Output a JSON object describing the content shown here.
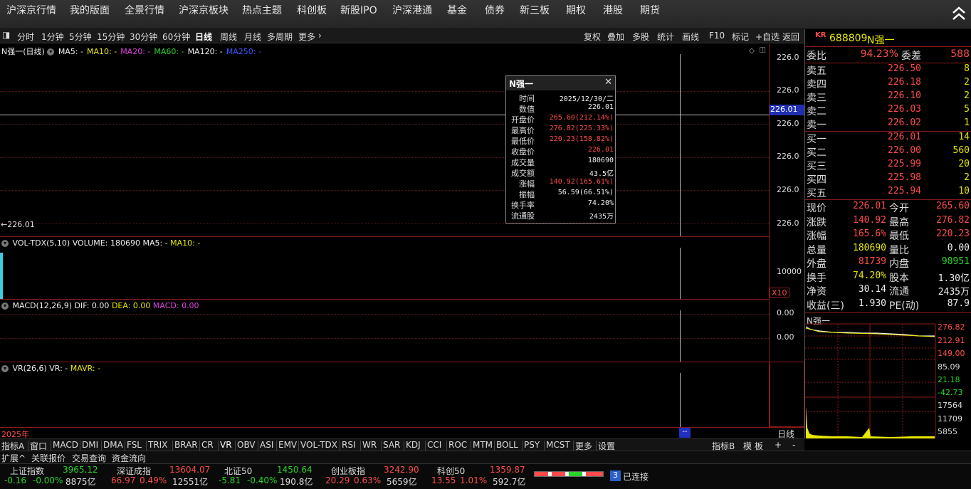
{
  "nav": {
    "items": [
      "沪深京行情",
      "我的版面",
      "全景行情",
      "沪深京板块",
      "热点主题",
      "科创板",
      "新股IPO",
      "沪深港通",
      "基金",
      "债券",
      "新三板",
      "期权",
      "港股",
      "期货"
    ]
  },
  "period": {
    "items": [
      "分时",
      "1分钟",
      "5分钟",
      "15分钟",
      "30分钟",
      "60分钟",
      "日线",
      "周线",
      "月线",
      "多周期",
      "更多"
    ],
    "active": "日线",
    "right_tools": [
      "复权",
      "叠加",
      "多股",
      "统计",
      "画线",
      "F10",
      "标记",
      "+自选",
      "返回"
    ]
  },
  "main_pane": {
    "title": "N强一(日线)",
    "ma": [
      {
        "label": "MA5: -",
        "color": "#eeeeee"
      },
      {
        "label": "MA10: -",
        "color": "#e8e800"
      },
      {
        "label": "MA20: -",
        "color": "#e040e0"
      },
      {
        "label": "MA60: -",
        "color": "#2ad32a"
      },
      {
        "label": "MA120: -",
        "color": "#eeeeee"
      },
      {
        "label": "MA250: -",
        "color": "#3a55ff"
      }
    ],
    "scale": [
      "226.0",
      "226.0",
      "226.0",
      "226.0",
      "226.0",
      "226.0"
    ],
    "price_tag": "226.01",
    "last_label": "←226.01"
  },
  "vol_pane": {
    "title": "VOL-TDX(5,10)",
    "volume": "VOLUME: 180690",
    "ma5": "MA5: -",
    "ma10": "MA10: -",
    "scale": "10000",
    "unit": "X10"
  },
  "macd_pane": {
    "title": "MACD(12,26,9)",
    "dif": "DIF: 0.00",
    "dea": "DEA: 0.00",
    "macd": "MACD: 0.00",
    "scale": [
      "0.00",
      "0.00"
    ]
  },
  "vr_pane": {
    "title": "VR(26,6)",
    "vr": "VR: -",
    "mavr": "MAVR: -"
  },
  "xaxis": {
    "year": "2025年",
    "period": "日线",
    "cursor": "--"
  },
  "popup": {
    "title": "N强一",
    "rows": [
      {
        "k": "时间",
        "v": "2025/12/30/二",
        "c": "white"
      },
      {
        "k": "数值",
        "v": "226.01",
        "c": "white"
      },
      {
        "k": "开盘价",
        "v": "265.60(212.14%)",
        "c": "red"
      },
      {
        "k": "最高价",
        "v": "276.82(225.33%)",
        "c": "red"
      },
      {
        "k": "最低价",
        "v": "220.23(158.82%)",
        "c": "red"
      },
      {
        "k": "收盘价",
        "v": "226.01",
        "c": "red"
      },
      {
        "k": "成交量",
        "v": "180690",
        "c": "white"
      },
      {
        "k": "成交额",
        "v": "43.5亿",
        "c": "white"
      },
      {
        "k": "涨幅",
        "v": "140.92(165.61%)",
        "c": "red"
      },
      {
        "k": "振幅",
        "v": "56.59(66.51%)",
        "c": "white"
      },
      {
        "k": "换手率",
        "v": "74.20%",
        "c": "white"
      },
      {
        "k": "流通股",
        "v": "2435万",
        "c": "white"
      }
    ]
  },
  "bottom_tabs": [
    "指标A",
    "窗口",
    "MACD",
    "DMI",
    "DMA",
    "FSL",
    "TRIX",
    "BRAR",
    "CR",
    "VR",
    "OBV",
    "ASI",
    "EMV",
    "VOL-TDX",
    "RSI",
    "WR",
    "SAR",
    "KDJ",
    "CCI",
    "ROC",
    "MTM",
    "BOLL",
    "PSY",
    "MCST",
    "更多",
    "设置"
  ],
  "bottom_right_tabs": [
    "指标B",
    "模 板",
    "+",
    "-"
  ],
  "toolbar2": [
    "扩展^",
    "关联报价",
    "交易查询",
    "资金流向"
  ],
  "indices": [
    {
      "name": "上证指数",
      "value": "3965.12",
      "chg": "-0.16",
      "pct": "-0.00%",
      "amt": "8875亿",
      "dir": "down"
    },
    {
      "name": "深证成指",
      "value": "13604.07",
      "chg": "66.97",
      "pct": "0.49%",
      "amt": "12551亿",
      "dir": "up"
    },
    {
      "name": "北证50",
      "value": "1450.64",
      "chg": "-5.81",
      "pct": "-0.40%",
      "amt": "190.8亿",
      "dir": "down"
    },
    {
      "name": "创业板指",
      "value": "3242.90",
      "chg": "20.29",
      "pct": "0.63%",
      "amt": "5659亿",
      "dir": "up"
    },
    {
      "name": "科创50",
      "value": "1359.87",
      "chg": "13.55",
      "pct": "1.01%",
      "amt": "592.7亿",
      "dir": "up"
    }
  ],
  "connection": {
    "count": "3",
    "label": "已连接"
  },
  "quote": {
    "badge": "KR",
    "code": "688809",
    "name": "N强一",
    "weibi_label": "委比",
    "weibi": "94.23%",
    "weicha_label": "委差",
    "weicha": "588",
    "asks": [
      {
        "label": "卖五",
        "price": "226.50",
        "qty": "8"
      },
      {
        "label": "卖四",
        "price": "226.18",
        "qty": "2"
      },
      {
        "label": "卖三",
        "price": "226.10",
        "qty": "2"
      },
      {
        "label": "卖二",
        "price": "226.03",
        "qty": "5"
      },
      {
        "label": "卖一",
        "price": "226.02",
        "qty": "1"
      }
    ],
    "bids": [
      {
        "label": "买一",
        "price": "226.01",
        "qty": "14"
      },
      {
        "label": "买二",
        "price": "226.00",
        "qty": "560"
      },
      {
        "label": "买三",
        "price": "225.99",
        "qty": "20"
      },
      {
        "label": "买四",
        "price": "225.98",
        "qty": "2"
      },
      {
        "label": "买五",
        "price": "225.94",
        "qty": "10"
      }
    ],
    "stats": [
      {
        "l1": "现价",
        "v1": "226.01",
        "c1": "red",
        "l2": "今开",
        "v2": "265.60",
        "c2": "red"
      },
      {
        "l1": "涨跌",
        "v1": "140.92",
        "c1": "red",
        "l2": "最高",
        "v2": "276.82",
        "c2": "red"
      },
      {
        "l1": "涨幅",
        "v1": "165.6%",
        "c1": "red",
        "l2": "最低",
        "v2": "220.23",
        "c2": "red"
      },
      {
        "l1": "总量",
        "v1": "180690",
        "c1": "yellow",
        "l2": "量比",
        "v2": "0.00",
        "c2": "white"
      },
      {
        "l1": "外盘",
        "v1": "81739",
        "c1": "red",
        "l2": "内盘",
        "v2": "98951",
        "c2": "green"
      },
      {
        "l1": "换手",
        "v1": "74.20%",
        "c1": "yellow",
        "l2": "股本",
        "v2": "1.30亿",
        "c2": "white"
      },
      {
        "l1": "净资",
        "v1": "30.14",
        "c1": "white",
        "l2": "流通",
        "v2": "2435万",
        "c2": "white"
      },
      {
        "l1": "收益(三)",
        "v1": "1.930",
        "c1": "white",
        "l2": "PE(动)",
        "v2": "87.9",
        "c2": "white"
      }
    ],
    "mini_title": "N强一",
    "mini_prices": [
      "276.82",
      "212.91",
      "149.00",
      "85.09",
      "21.18",
      "-42.73"
    ],
    "mini_vols": [
      "17564",
      "11709",
      "5855"
    ]
  },
  "colors": {
    "up": "#ff4b4b",
    "down": "#2ad32a",
    "grid": "#8b1a1a"
  }
}
